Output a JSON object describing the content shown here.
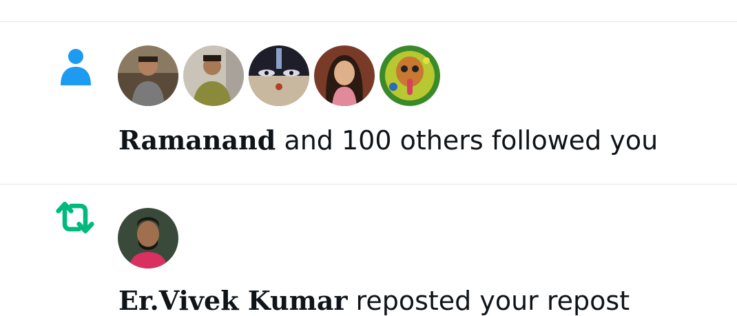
{
  "notifications": [
    {
      "type": "follow",
      "icon": "person-icon",
      "icon_color": "#1d9bf0",
      "avatars": [
        "avatar-1",
        "avatar-2",
        "avatar-3",
        "avatar-4",
        "avatar-5"
      ],
      "actor": "Ramanand",
      "text": " and 100 others followed you"
    },
    {
      "type": "repost",
      "icon": "repost-icon",
      "icon_color": "#00ba7c",
      "avatars": [
        "avatar-6"
      ],
      "actor": "Er.Vivek Kumar",
      "text": " reposted your repost"
    }
  ],
  "colors": {
    "divider": "#e1e8ed",
    "text": "#0f1419",
    "follow_blue": "#1d9bf0",
    "repost_green": "#00ba7c"
  }
}
